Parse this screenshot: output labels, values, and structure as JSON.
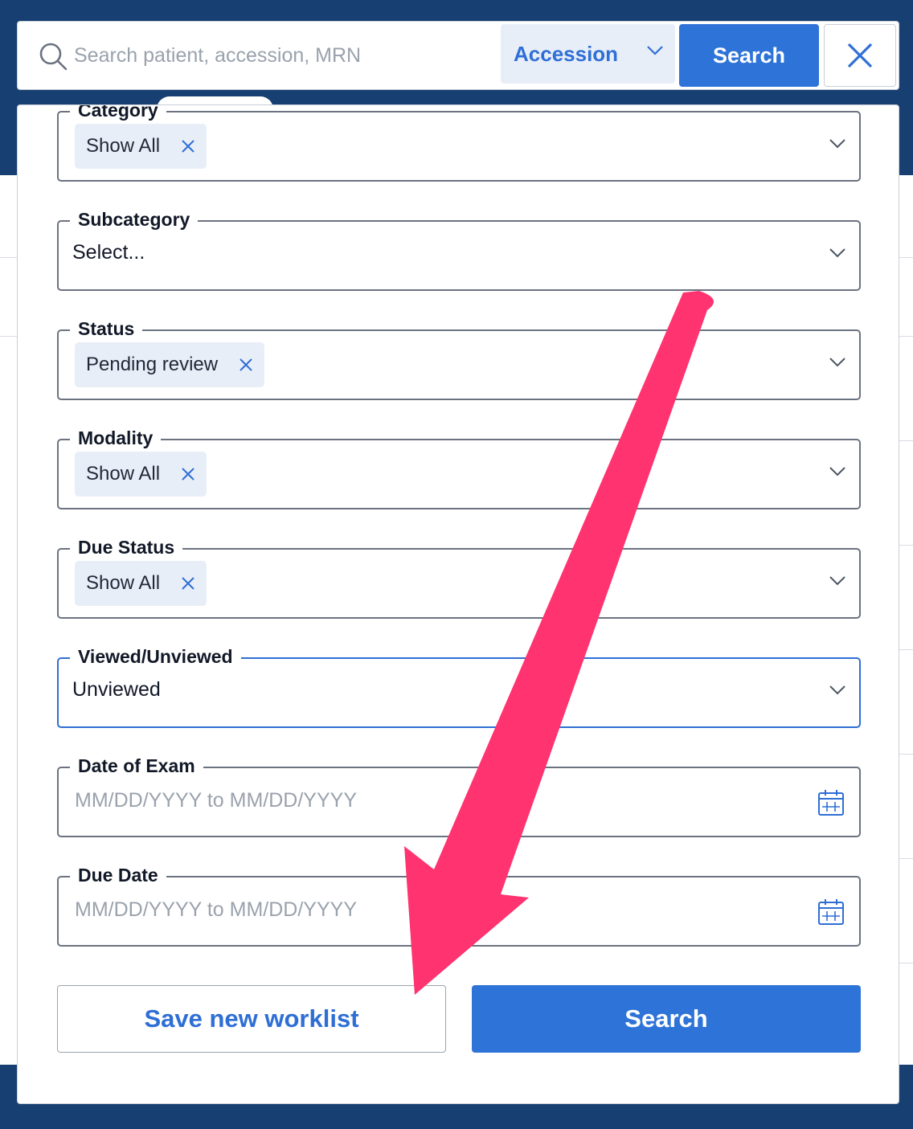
{
  "search": {
    "placeholder": "Search patient, accession, MRN",
    "type_selected": "Accession",
    "button_label": "Search"
  },
  "filters": {
    "category": {
      "label": "Category",
      "chip": "Show All"
    },
    "subcategory": {
      "label": "Subcategory",
      "value": "Select..."
    },
    "status": {
      "label": "Status",
      "chip": "Pending review"
    },
    "modality": {
      "label": "Modality",
      "chip": "Show All"
    },
    "due_status": {
      "label": "Due Status",
      "chip": "Show All"
    },
    "viewed": {
      "label": "Viewed/Unviewed",
      "value": "Unviewed"
    },
    "date_of_exam": {
      "label": "Date of Exam",
      "placeholder": "MM/DD/YYYY to MM/DD/YYYY"
    },
    "due_date": {
      "label": "Due Date",
      "placeholder": "MM/DD/YYYY to MM/DD/YYYY"
    }
  },
  "actions": {
    "save_label": "Save new worklist",
    "search_label": "Search"
  },
  "colors": {
    "brand_navy": "#173f72",
    "primary_blue": "#2e73d8",
    "chip_bg": "#e8eef8",
    "annotation_arrow": "#ff3370"
  },
  "icons": {
    "search": "search-icon",
    "dropdown": "chevron-down-icon",
    "remove": "close-icon",
    "calendar": "calendar-icon",
    "annotation": "arrow-annotation"
  }
}
